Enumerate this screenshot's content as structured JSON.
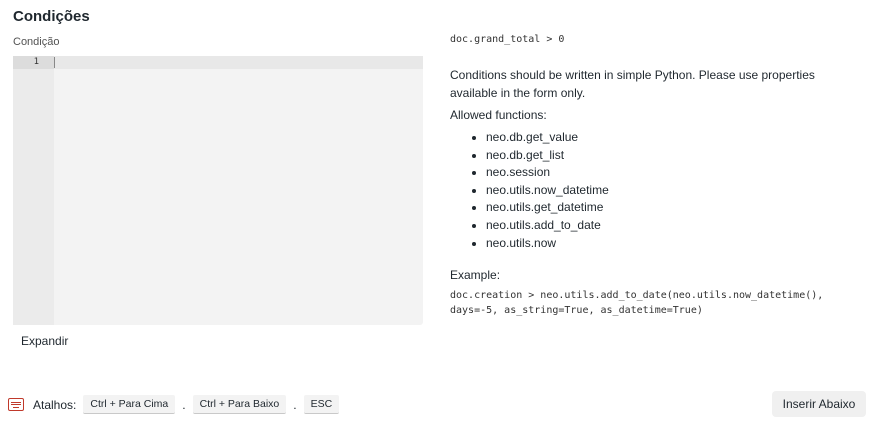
{
  "section": {
    "title": "Condições"
  },
  "editor": {
    "label": "Condição",
    "line_numbers": [
      "1"
    ]
  },
  "expand": {
    "label": "Expandir"
  },
  "help": {
    "example_top": "doc.grand_total > 0",
    "description": "Conditions should be written in simple Python. Please use properties available in the form only.",
    "allowed_title": "Allowed functions:",
    "functions": [
      "neo.db.get_value",
      "neo.db.get_list",
      "neo.session",
      "neo.utils.now_datetime",
      "neo.utils.get_datetime",
      "neo.utils.add_to_date",
      "neo.utils.now"
    ],
    "example_label": "Example:",
    "example_code_line1": "doc.creation > neo.utils.add_to_date(neo.utils.now_datetime(),",
    "example_code_line2": "days=-5, as_string=True, as_datetime=True)"
  },
  "shortcuts": {
    "label": "Atalhos:",
    "keys": [
      "Ctrl + Para Cima",
      "Ctrl + Para Baixo",
      "ESC"
    ],
    "separator": "."
  },
  "footer": {
    "insert_label": "Inserir Abaixo"
  },
  "icons": {
    "shortcuts": "keyboard-icon"
  },
  "colors": {
    "accent": "#c0392b",
    "editor_bg": "#f3f3f3",
    "button_bg": "#f0f0f0"
  }
}
